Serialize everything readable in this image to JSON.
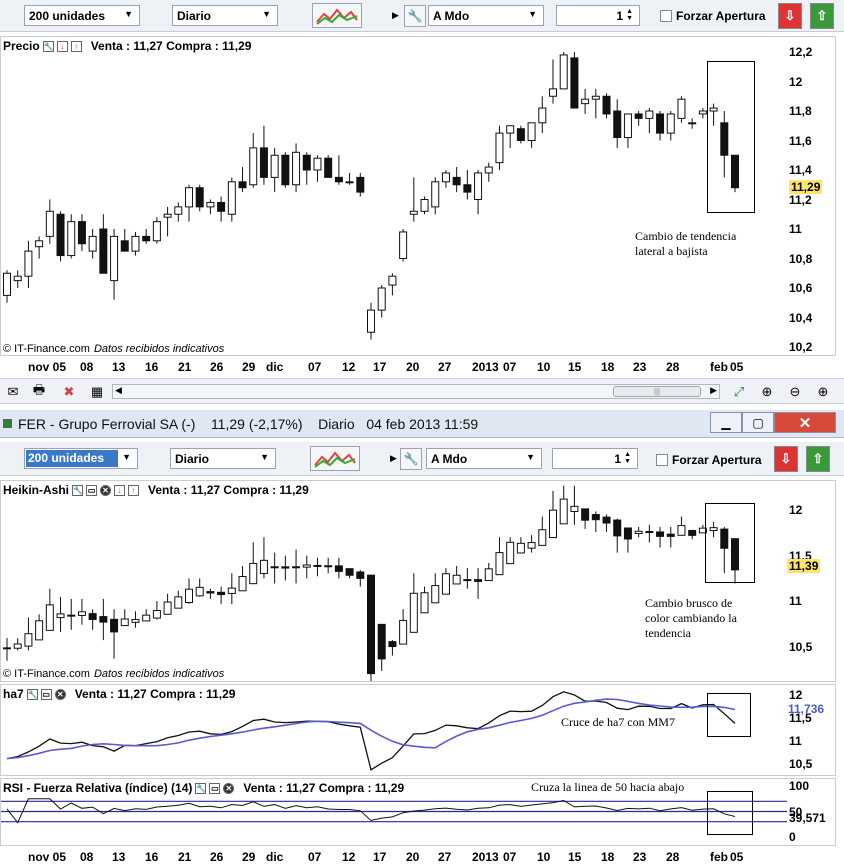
{
  "toolbar1": {
    "units": "200 unidades",
    "period": "Diario",
    "order_type": "A Mdo",
    "quantity": "1",
    "force_open": "Forzar Apertura"
  },
  "toolbar2": {
    "units": "200 unidades",
    "period": "Diario",
    "order_type": "A Mdo",
    "quantity": "1",
    "force_open": "Forzar Apertura"
  },
  "window": {
    "title": "FER - Grupo Ferrovial SA (-)",
    "price": "11,29 (-2,17%)",
    "period": "Diario",
    "datetime": "04 feb 2013 11:59"
  },
  "price_chart": {
    "name": "Precio",
    "legend_values": "Venta : 11,27 Compra : 11,29",
    "current_price": "11,29",
    "credit": "© IT-Finance.com",
    "credit_note": "Datos recibidos indicativos",
    "annotation": [
      "Cambio de tendencia",
      "lateral a bajista"
    ],
    "yticks": [
      "12,2",
      "12",
      "11,8",
      "11,6",
      "11,4",
      "11,2",
      "11",
      "10,8",
      "10,6",
      "10,4",
      "10,2"
    ]
  },
  "ha_chart": {
    "name": "Heikin-Ashi",
    "legend_values": "Venta : 11,27 Compra : 11,29",
    "current_price": "11,39",
    "credit": "© IT-Finance.com",
    "credit_note": "Datos recibidos indicativos",
    "annotation": [
      "Cambio brusco de",
      "color cambiando la",
      "tendencia"
    ],
    "yticks": [
      "12",
      "11,5",
      "11",
      "10,5"
    ]
  },
  "ha7_chart": {
    "name": "ha7",
    "legend_values": "Venta : 11,27 Compra : 11,29",
    "current_value": "11,736",
    "annotation": "Cruce de ha7 con MM7",
    "yticks": [
      "12",
      "11,5",
      "11",
      "10,5"
    ]
  },
  "rsi_chart": {
    "name": "RSI - Fuerza Relativa (índice) (14)",
    "legend_values": "Venta : 11,27 Compra : 11,29",
    "current_value": "39,571",
    "annotation": "Cruza la linea de 50 hacia abajo",
    "yticks": [
      "100",
      "50",
      "0"
    ]
  },
  "x_axis": [
    "nov 05",
    "08",
    "13",
    "16",
    "21",
    "26",
    "29",
    "dic",
    "07",
    "12",
    "17",
    "20",
    "27",
    "2013",
    "07",
    "10",
    "15",
    "18",
    "23",
    "28",
    "feb",
    "05"
  ],
  "colors": {
    "up": "#ffffff",
    "down": "#111111",
    "ma": "#5a5ad0",
    "accent": "#ffe46a"
  },
  "chart_data": {
    "type": "candlestick",
    "series": [
      {
        "name": "Precio",
        "ohlc": [
          [
            10.55,
            10.72,
            10.5,
            10.7
          ],
          [
            10.65,
            10.72,
            10.6,
            10.68
          ],
          [
            10.68,
            10.92,
            10.6,
            10.85
          ],
          [
            10.88,
            10.95,
            10.8,
            10.92
          ],
          [
            10.95,
            11.2,
            10.9,
            11.12
          ],
          [
            11.1,
            11.12,
            10.78,
            10.82
          ],
          [
            10.82,
            11.1,
            10.8,
            11.05
          ],
          [
            11.05,
            11.1,
            10.85,
            10.9
          ],
          [
            10.85,
            11.0,
            10.8,
            10.95
          ],
          [
            11.0,
            11.1,
            10.7,
            10.7
          ],
          [
            10.65,
            11.0,
            10.52,
            10.95
          ],
          [
            10.92,
            11.0,
            10.85,
            10.85
          ],
          [
            10.85,
            10.98,
            10.82,
            10.95
          ],
          [
            10.95,
            11.0,
            10.9,
            10.92
          ],
          [
            10.92,
            11.08,
            10.9,
            11.05
          ],
          [
            11.08,
            11.15,
            10.95,
            11.1
          ],
          [
            11.1,
            11.18,
            11.05,
            11.15
          ],
          [
            11.15,
            11.3,
            11.05,
            11.28
          ],
          [
            11.28,
            11.3,
            11.12,
            11.15
          ],
          [
            11.15,
            11.2,
            11.1,
            11.18
          ],
          [
            11.18,
            11.22,
            11.05,
            11.12
          ],
          [
            11.1,
            11.35,
            11.05,
            11.32
          ],
          [
            11.32,
            11.42,
            11.25,
            11.28
          ],
          [
            11.3,
            11.65,
            11.28,
            11.55
          ],
          [
            11.55,
            11.7,
            11.3,
            11.35
          ],
          [
            11.35,
            11.55,
            11.25,
            11.5
          ],
          [
            11.5,
            11.52,
            11.28,
            11.3
          ],
          [
            11.3,
            11.58,
            11.25,
            11.52
          ],
          [
            11.5,
            11.52,
            11.3,
            11.4
          ],
          [
            11.4,
            11.5,
            11.32,
            11.48
          ],
          [
            11.48,
            11.5,
            11.35,
            11.35
          ],
          [
            11.35,
            11.5,
            11.3,
            11.32
          ],
          [
            11.32,
            11.38,
            11.3,
            11.32
          ],
          [
            11.35,
            11.38,
            11.22,
            11.25
          ],
          [
            10.3,
            10.5,
            10.25,
            10.45
          ],
          [
            10.45,
            10.62,
            10.4,
            10.6
          ],
          [
            10.62,
            10.7,
            10.55,
            10.68
          ],
          [
            10.8,
            11.0,
            10.78,
            10.98
          ],
          [
            11.1,
            11.35,
            11.05,
            11.12
          ],
          [
            11.12,
            11.22,
            11.1,
            11.2
          ],
          [
            11.15,
            11.35,
            11.1,
            11.32
          ],
          [
            11.32,
            11.4,
            11.28,
            11.38
          ],
          [
            11.35,
            11.42,
            11.25,
            11.3
          ],
          [
            11.3,
            11.4,
            11.2,
            11.25
          ],
          [
            11.2,
            11.4,
            11.1,
            11.38
          ],
          [
            11.38,
            11.45,
            11.32,
            11.42
          ],
          [
            11.45,
            11.7,
            11.4,
            11.65
          ],
          [
            11.65,
            11.7,
            11.55,
            11.7
          ],
          [
            11.68,
            11.7,
            11.58,
            11.6
          ],
          [
            11.6,
            11.72,
            11.55,
            11.72
          ],
          [
            11.72,
            11.9,
            11.65,
            11.82
          ],
          [
            11.9,
            12.15,
            11.85,
            11.95
          ],
          [
            11.95,
            12.2,
            11.95,
            12.18
          ],
          [
            12.16,
            12.2,
            11.82,
            11.82
          ],
          [
            11.85,
            11.95,
            11.78,
            11.88
          ],
          [
            11.88,
            11.95,
            11.75,
            11.9
          ],
          [
            11.9,
            11.92,
            11.75,
            11.78
          ],
          [
            11.8,
            11.88,
            11.55,
            11.62
          ],
          [
            11.62,
            11.78,
            11.55,
            11.78
          ],
          [
            11.78,
            11.8,
            11.7,
            11.75
          ],
          [
            11.75,
            11.82,
            11.65,
            11.8
          ],
          [
            11.78,
            11.8,
            11.6,
            11.65
          ],
          [
            11.65,
            11.8,
            11.6,
            11.78
          ],
          [
            11.75,
            11.9,
            11.72,
            11.88
          ],
          [
            11.72,
            11.75,
            11.68,
            11.72
          ],
          [
            11.78,
            11.82,
            11.75,
            11.8
          ],
          [
            11.8,
            11.85,
            11.7,
            11.82
          ],
          [
            11.72,
            11.8,
            11.35,
            11.5
          ],
          [
            11.5,
            11.5,
            11.25,
            11.28
          ]
        ]
      }
    ]
  }
}
